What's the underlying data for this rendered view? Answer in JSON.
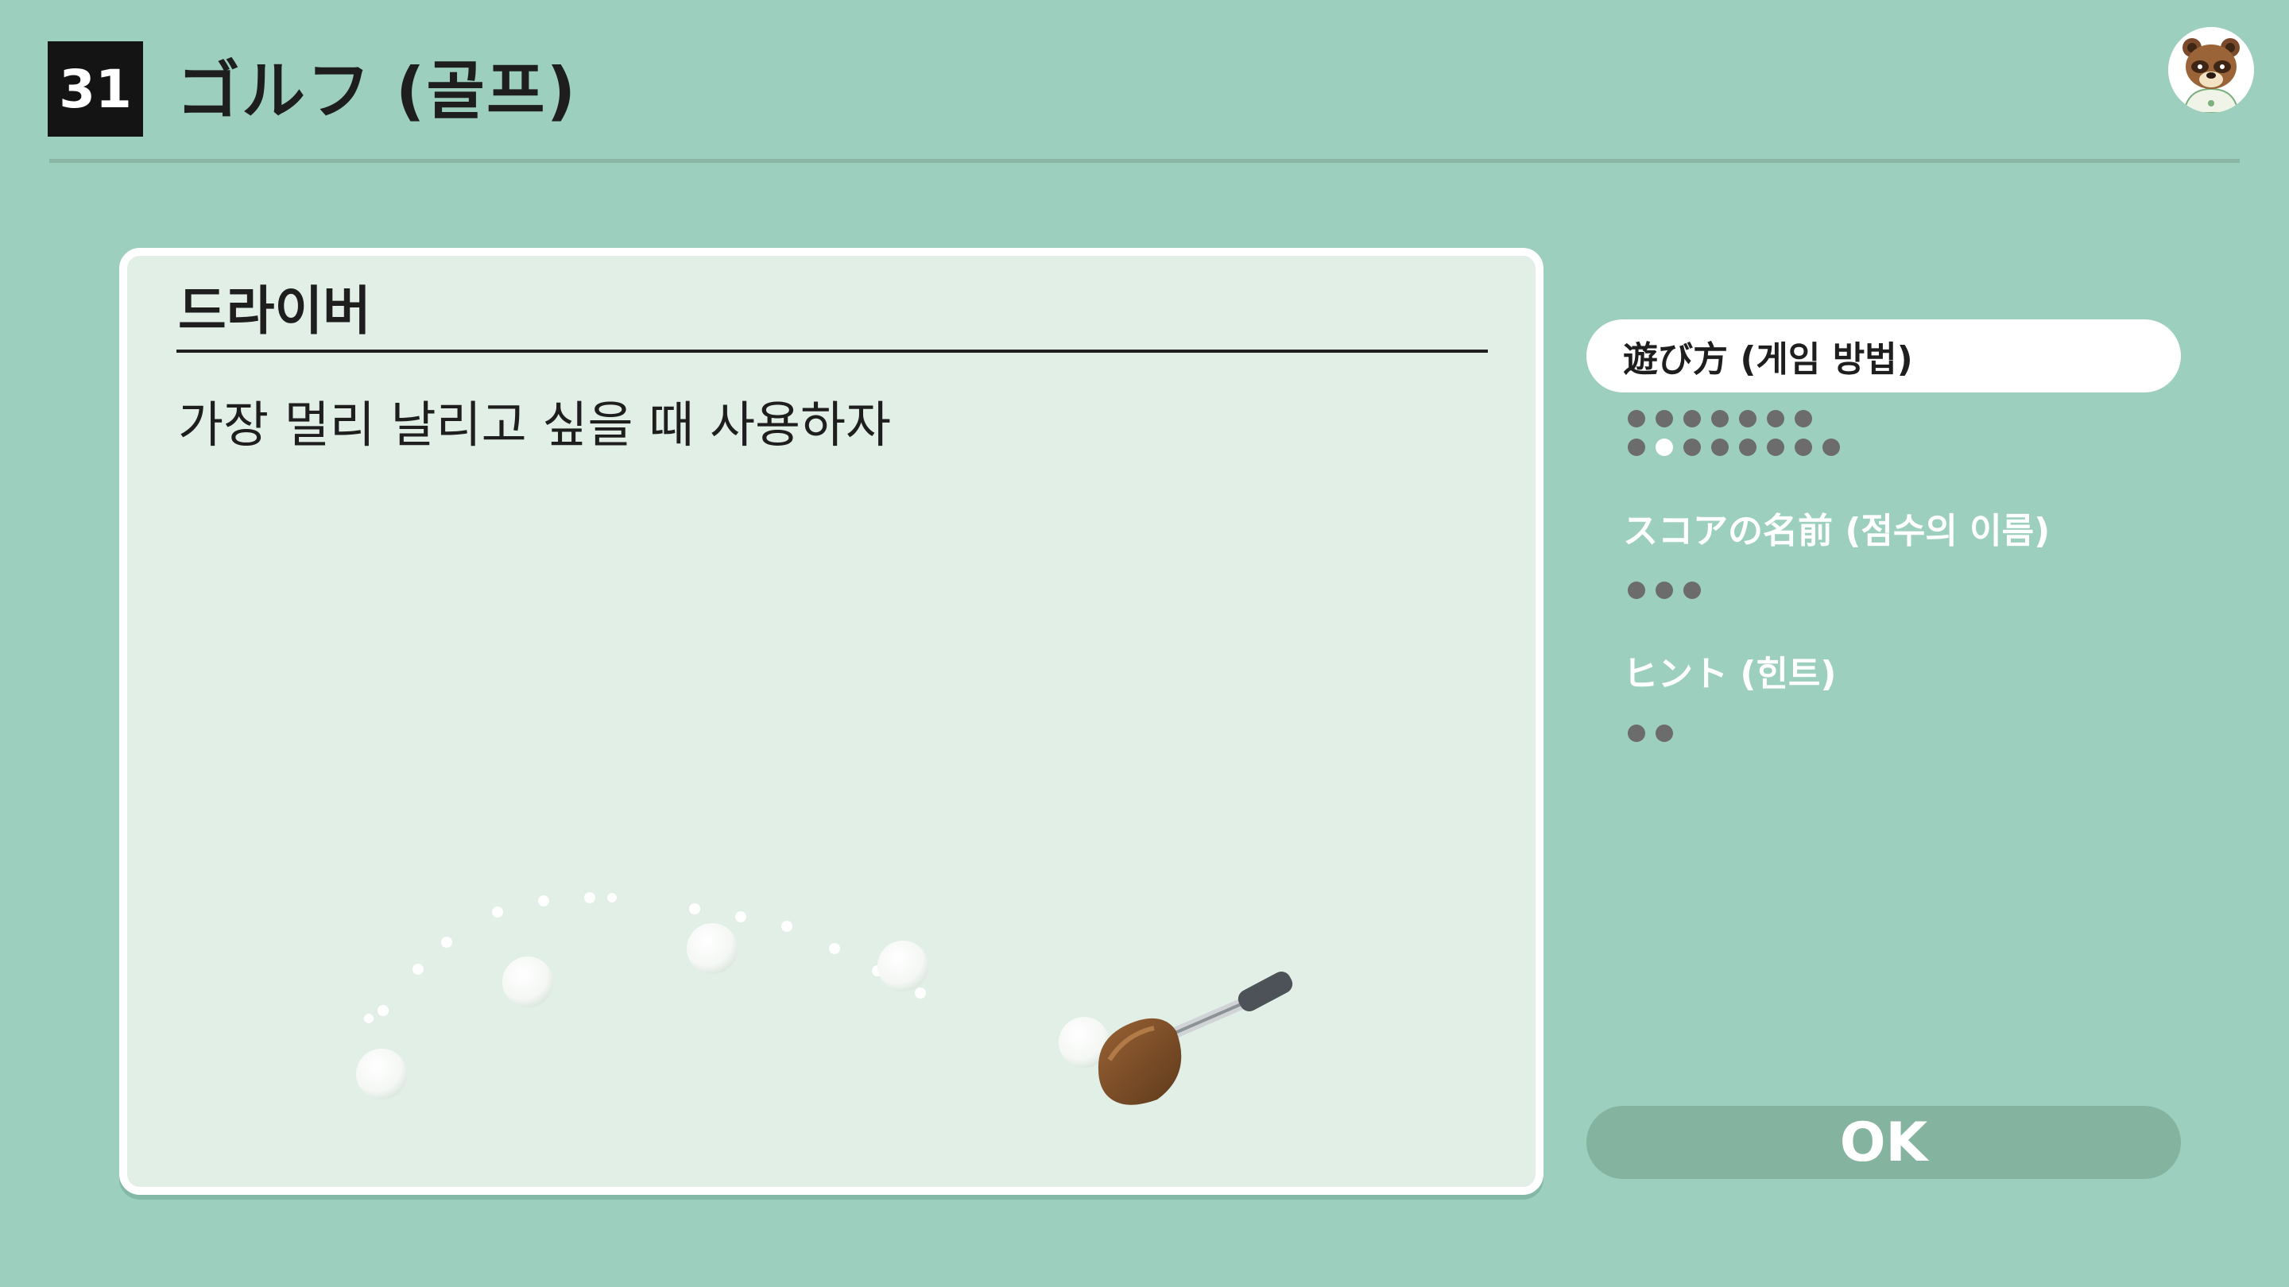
{
  "header": {
    "number": "31",
    "title": "ゴルフ (골프)"
  },
  "panel": {
    "title": "드라이버",
    "body": "가장 멀리 날리고 싶을 때 사용하자"
  },
  "sidebar": {
    "items": [
      {
        "label": "遊び方 (게임 방법)",
        "active": true,
        "pages": 15,
        "current_page": 9
      },
      {
        "label": "スコアの名前 (점수의 이름)",
        "active": false,
        "pages": 3
      },
      {
        "label": "ヒント (힌트)",
        "active": false,
        "pages": 2
      }
    ]
  },
  "ok_button": {
    "label": "OK"
  },
  "colors": {
    "background": "#9dcfbe",
    "panel": "#e1efe6",
    "active_item": "#ffffff",
    "dot": "#6c6c6c",
    "dot_active": "#ffffff",
    "ok_button": "#84b3a0"
  },
  "icons": {
    "avatar": "tom-nook-avatar-icon",
    "illustration": "golf-driver-trajectory-illustration"
  }
}
